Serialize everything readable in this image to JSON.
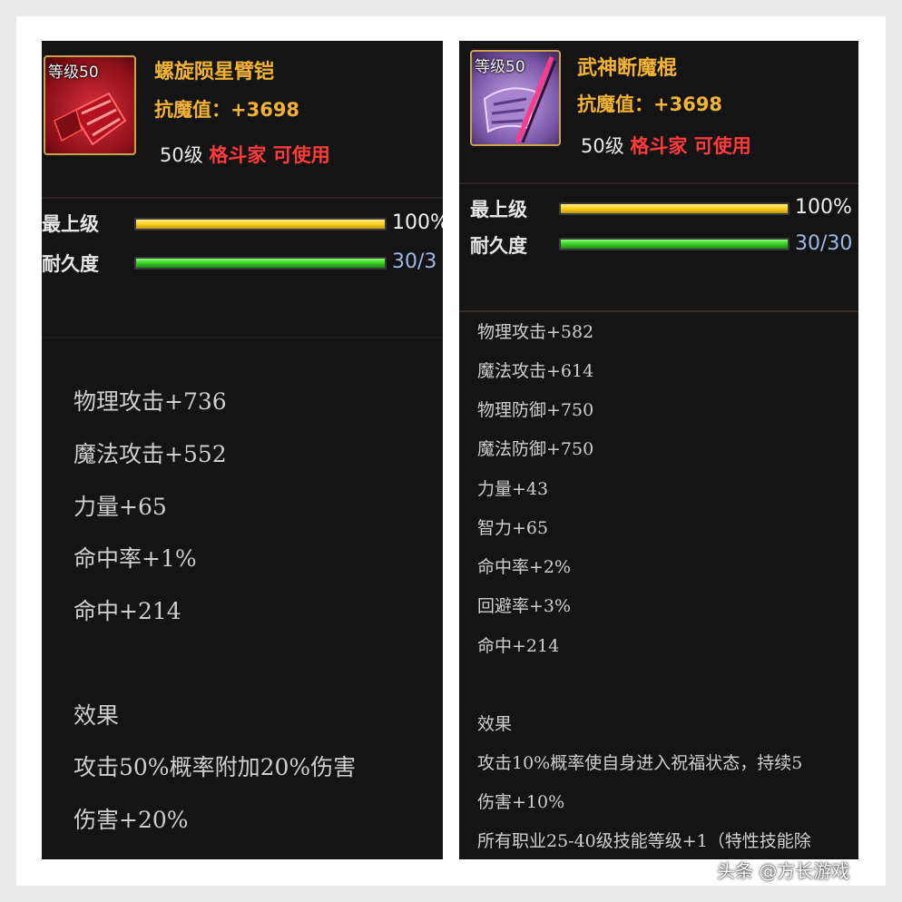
{
  "left_item": {
    "level_tag": "等级50",
    "name": "螺旋陨星臂铠",
    "resist": "抗魔值：+3698",
    "req_level": "50级",
    "req_class": "格斗家 可使用",
    "bars": [
      {
        "label": "最上级",
        "value": "100%",
        "fill": 1.0
      },
      {
        "label": "耐久度",
        "value": "30/3",
        "fill": 1.0
      }
    ],
    "stats": [
      "物理攻击+736",
      "魔法攻击+552",
      "力量+65",
      "命中率+1%",
      "命中+214"
    ],
    "effect_title": "效果",
    "effects": [
      "攻击50%概率附加20%伤害",
      "伤害+20%"
    ]
  },
  "right_item": {
    "level_tag": "等级50",
    "name": "武神断魔棍",
    "resist": "抗魔值：+3698",
    "req_level": "50级",
    "req_class": "格斗家 可使用",
    "bars": [
      {
        "label": "最上级",
        "value": "100%",
        "fill": 1.0
      },
      {
        "label": "耐久度",
        "value": "30/30",
        "fill": 1.0
      }
    ],
    "stats": [
      "物理攻击+582",
      "魔法攻击+614",
      "物理防御+750",
      "魔法防御+750",
      "力量+43",
      "智力+65",
      "命中率+2%",
      "回避率+3%",
      "命中+214"
    ],
    "effect_title": "效果",
    "effects": [
      "攻击10%概率使自身进入祝福状态，持续5",
      "伤害+10%",
      "所有职业25-40级技能等级+1（特性技能除"
    ]
  },
  "watermark": "头条 @方长游戏",
  "colors": {
    "background": "#141414",
    "item_name": "#f2b236",
    "class_req": "#ff3b3b",
    "bar_gold": "#ffd321",
    "bar_green": "#3ed32a",
    "durability_text": "#9db9e6"
  }
}
